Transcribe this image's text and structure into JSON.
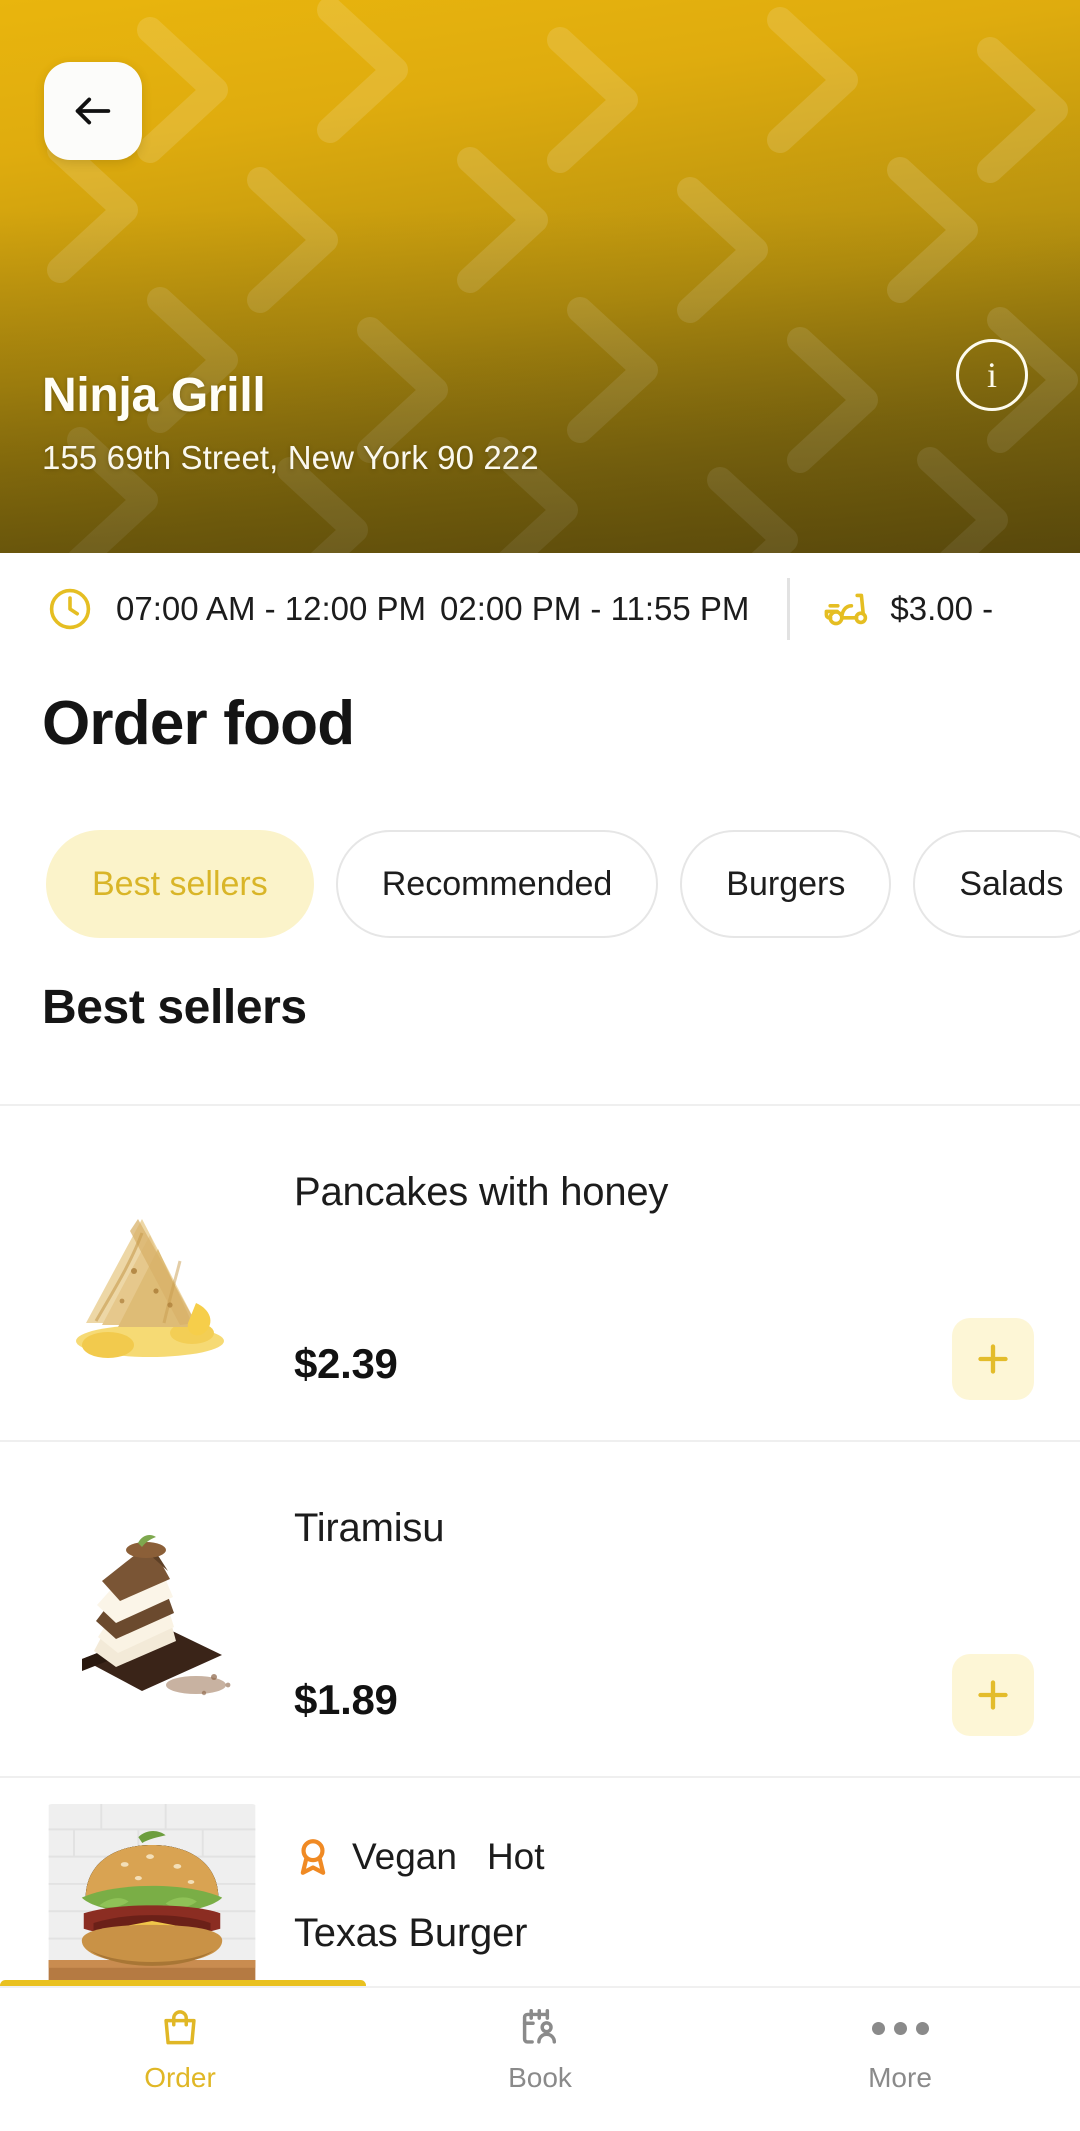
{
  "header": {
    "back_icon": "arrow-left-icon",
    "restaurant_name": "Ninja Grill",
    "address": "155 69th Street, New York 90 222",
    "info_icon": "info-icon",
    "info_label": "i",
    "gradient_top": "#E9B50D",
    "gradient_bottom": "#6B5810"
  },
  "info_strip": {
    "clock_icon": "clock-icon",
    "hours_part1": "07:00 AM - 12:00 PM",
    "hours_part2": "02:00 PM - 11:55 PM",
    "scooter_icon": "scooter-icon",
    "delivery_fee": "$3.00 -"
  },
  "order_section": {
    "title": "Order food",
    "chips": [
      {
        "label": "Best sellers",
        "active": true
      },
      {
        "label": "Recommended",
        "active": false
      },
      {
        "label": "Burgers",
        "active": false
      },
      {
        "label": "Salads",
        "active": false
      }
    ],
    "list_heading": "Best sellers"
  },
  "menu_items": [
    {
      "name": "Pancakes with honey",
      "price": "$2.39",
      "add_icon": "plus-icon",
      "image": "pancakes-thumbnail"
    },
    {
      "name": "Tiramisu",
      "price": "$1.89",
      "add_icon": "plus-icon",
      "image": "tiramisu-thumbnail"
    },
    {
      "name": "Texas Burger",
      "badge_icon": "award-ribbon-icon",
      "badge_1": "Vegan",
      "badge_2": "Hot",
      "image": "burger-thumbnail"
    }
  ],
  "bottom_nav": [
    {
      "label": "Order",
      "icon": "shopping-bag-icon",
      "active": true
    },
    {
      "label": "Book",
      "icon": "calendar-person-icon",
      "active": false
    },
    {
      "label": "More",
      "icon": "three-dots-icon",
      "active": false
    }
  ],
  "colors": {
    "accent": "#E0B726",
    "chip_active_bg": "#FBF3CA",
    "chip_active_text": "#D9B528",
    "add_button_bg": "#FDF6D6",
    "badge_icon": "#F08A24",
    "scroll_indicator": "#E9C11F"
  }
}
